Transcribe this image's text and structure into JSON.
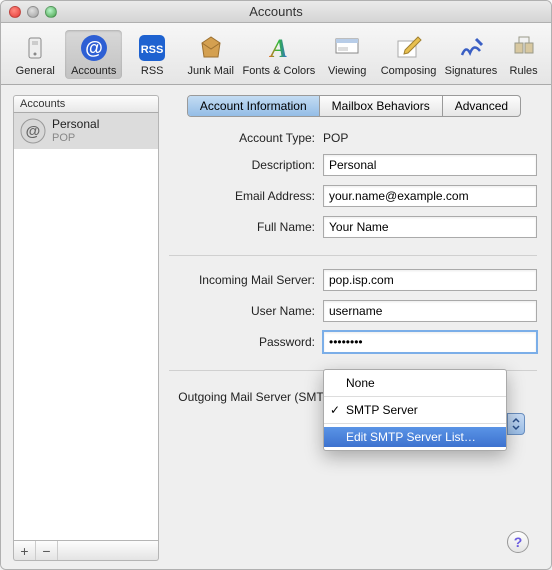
{
  "window": {
    "title": "Accounts"
  },
  "toolbar": {
    "items": [
      {
        "label": "General"
      },
      {
        "label": "Accounts"
      },
      {
        "label": "RSS"
      },
      {
        "label": "Junk Mail"
      },
      {
        "label": "Fonts & Colors"
      },
      {
        "label": "Viewing"
      },
      {
        "label": "Composing"
      },
      {
        "label": "Signatures"
      },
      {
        "label": "Rules"
      }
    ]
  },
  "sidebar": {
    "header": "Accounts",
    "accounts": [
      {
        "name": "Personal",
        "type": "POP"
      }
    ],
    "add": "+",
    "remove": "−"
  },
  "tabs": [
    {
      "label": "Account Information",
      "active": true
    },
    {
      "label": "Mailbox Behaviors"
    },
    {
      "label": "Advanced"
    }
  ],
  "form": {
    "account_type_label": "Account Type:",
    "account_type_value": "POP",
    "description_label": "Description:",
    "description_value": "Personal",
    "email_label": "Email Address:",
    "email_value": "your.name@example.com",
    "fullname_label": "Full Name:",
    "fullname_value": "Your Name",
    "incoming_label": "Incoming Mail Server:",
    "incoming_value": "pop.isp.com",
    "username_label": "User Name:",
    "username_value": "username",
    "password_label": "Password:",
    "password_value": "••••••••",
    "smtp_label": "Outgoing Mail Server (SMTP):"
  },
  "smtp_menu": {
    "options": [
      {
        "label": "None"
      },
      {
        "label": "SMTP Server",
        "checked": true
      },
      {
        "label": "Edit SMTP Server List…",
        "highlight": true
      }
    ]
  },
  "help": "?"
}
